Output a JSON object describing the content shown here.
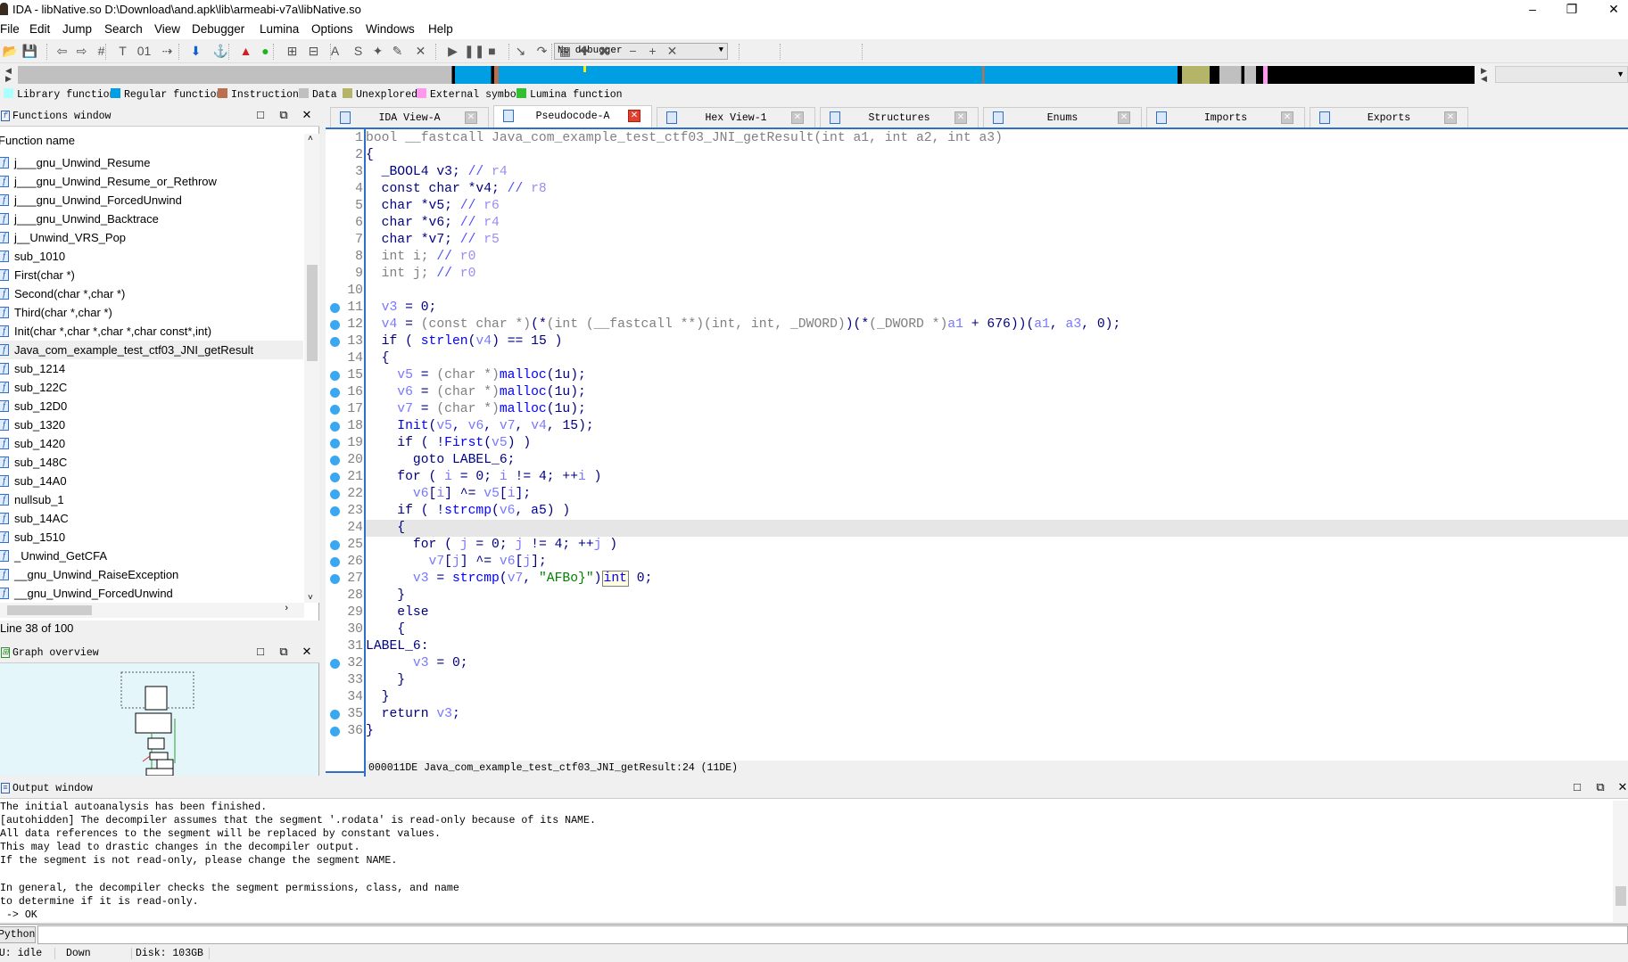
{
  "window": {
    "title": "IDA - libNative.so D:\\Download\\and.apk\\lib\\armeabi-v7a\\libNative.so",
    "minimize": "–",
    "restore": "❐",
    "close": "✕"
  },
  "menu": [
    "File",
    "Edit",
    "Jump",
    "Search",
    "View",
    "Debugger",
    "Lumina",
    "Options",
    "Windows",
    "Help"
  ],
  "toolbar": {
    "debugger_select": "No debugger",
    "icons": [
      "open-icon",
      "save-icon",
      "back-icon",
      "forward-icon",
      "binary-search-icon",
      "text-search-icon",
      "immediate-search-icon",
      "search-next-icon",
      "jump-down-icon",
      "anchor-icon",
      "report-icon",
      "green-ball-icon",
      "code-icon",
      "data-icon",
      "ascii-icon",
      "struct-icon",
      "patch-icon",
      "edit-icon",
      "undefine-icon",
      "run-icon",
      "pause-icon",
      "stop-icon",
      "step-into-icon",
      "step-over-icon",
      "breakpoints-icon",
      "add-breakpoint-icon",
      "delete-breakpoint-icon",
      "collapse-icon",
      "expand-icon",
      "close-icon"
    ]
  },
  "legend": [
    {
      "label": "Library function",
      "color": "#aaffff"
    },
    {
      "label": "Regular function",
      "color": "#009fe3"
    },
    {
      "label": "Instruction",
      "color": "#b87050"
    },
    {
      "label": "Data",
      "color": "#c0c0c0"
    },
    {
      "label": "Unexplored",
      "color": "#b5b56a"
    },
    {
      "label": "External symbol",
      "color": "#ff99ee"
    },
    {
      "label": "Lumina function",
      "color": "#30c030"
    }
  ],
  "functions_window": {
    "title": "Functions window",
    "column": "Function name",
    "selected_index": 10,
    "items": [
      "j___gnu_Unwind_Resume",
      "j___gnu_Unwind_Resume_or_Rethrow",
      "j___gnu_Unwind_ForcedUnwind",
      "j___gnu_Unwind_Backtrace",
      "j__Unwind_VRS_Pop",
      "sub_1010",
      "First(char *)",
      "Second(char *,char *)",
      "Third(char *,char *)",
      "Init(char *,char *,char *,char const*,int)",
      "Java_com_example_test_ctf03_JNI_getResult",
      "sub_1214",
      "sub_122C",
      "sub_12D0",
      "sub_1320",
      "sub_1420",
      "sub_148C",
      "sub_14A0",
      "nullsub_1",
      "sub_14AC",
      "sub_1510",
      "_Unwind_GetCFA",
      "__gnu_Unwind_RaiseException",
      "__gnu_Unwind_ForcedUnwind"
    ],
    "status": "Line 38 of 100"
  },
  "graph_overview": {
    "title": "Graph overview"
  },
  "tabs": [
    {
      "label": "IDA View-A",
      "active": false
    },
    {
      "label": "Pseudocode-A",
      "active": true
    },
    {
      "label": "Hex View-1",
      "active": false
    },
    {
      "label": "Structures",
      "active": false
    },
    {
      "label": "Enums",
      "active": false
    },
    {
      "label": "Imports",
      "active": false
    },
    {
      "label": "Exports",
      "active": false
    }
  ],
  "pseudocode": {
    "highlighted_line": 24,
    "breakpoint_lines": [
      11,
      12,
      13,
      15,
      16,
      17,
      18,
      19,
      20,
      21,
      22,
      23,
      25,
      26,
      27,
      32,
      35,
      36
    ],
    "lines": [
      [
        [
          "t",
          "bool __fastcall Java_com_example_test_ctf03_JNI_getResult(int a1, int a2, int a3)"
        ]
      ],
      [
        [
          "p",
          "{"
        ]
      ],
      [
        [
          "p",
          "  _BOOL4 v3; "
        ],
        [
          "c",
          "// "
        ],
        [
          "r",
          "r4"
        ]
      ],
      [
        [
          "p",
          "  const char *v4; "
        ],
        [
          "c",
          "// "
        ],
        [
          "r",
          "r8"
        ]
      ],
      [
        [
          "p",
          "  char *v5; "
        ],
        [
          "c",
          "// "
        ],
        [
          "r",
          "r6"
        ]
      ],
      [
        [
          "p",
          "  char *v6; "
        ],
        [
          "c",
          "// "
        ],
        [
          "r",
          "r4"
        ]
      ],
      [
        [
          "p",
          "  char *v7; "
        ],
        [
          "c",
          "// "
        ],
        [
          "r",
          "r5"
        ]
      ],
      [
        [
          "t",
          "  int i; "
        ],
        [
          "c",
          "// "
        ],
        [
          "r",
          "r0"
        ]
      ],
      [
        [
          "t",
          "  int j; "
        ],
        [
          "c",
          "// "
        ],
        [
          "r",
          "r0"
        ]
      ],
      [],
      [
        [
          "v",
          "  v3"
        ],
        [
          "p",
          " = 0;"
        ]
      ],
      [
        [
          "v",
          "  v4"
        ],
        [
          "p",
          " = "
        ],
        [
          "t",
          "(const char *)"
        ],
        [
          "p",
          "(*"
        ],
        [
          "t",
          "(int (__fastcall **)(int, int, _DWORD)"
        ],
        [
          "p",
          ")(*"
        ],
        [
          "t",
          "(_DWORD *)"
        ],
        [
          "v",
          "a1"
        ],
        [
          "p",
          " + 676))("
        ],
        [
          "v",
          "a1"
        ],
        [
          "p",
          ", "
        ],
        [
          "v",
          "a3"
        ],
        [
          "p",
          ", 0);"
        ]
      ],
      [
        [
          "p",
          "  if ( "
        ],
        [
          "f",
          "strlen"
        ],
        [
          "p",
          "("
        ],
        [
          "v",
          "v4"
        ],
        [
          "p",
          ") == 15 )"
        ]
      ],
      [
        [
          "p",
          "  {"
        ]
      ],
      [
        [
          "v",
          "    v5"
        ],
        [
          "p",
          " = "
        ],
        [
          "t",
          "(char *)"
        ],
        [
          "f",
          "malloc"
        ],
        [
          "p",
          "(1u);"
        ]
      ],
      [
        [
          "v",
          "    v6"
        ],
        [
          "p",
          " = "
        ],
        [
          "t",
          "(char *)"
        ],
        [
          "f",
          "malloc"
        ],
        [
          "p",
          "(1u);"
        ]
      ],
      [
        [
          "v",
          "    v7"
        ],
        [
          "p",
          " = "
        ],
        [
          "t",
          "(char *)"
        ],
        [
          "f",
          "malloc"
        ],
        [
          "p",
          "(1u);"
        ]
      ],
      [
        [
          "f",
          "    Init"
        ],
        [
          "p",
          "("
        ],
        [
          "v",
          "v5"
        ],
        [
          "p",
          ", "
        ],
        [
          "v",
          "v6"
        ],
        [
          "p",
          ", "
        ],
        [
          "v",
          "v7"
        ],
        [
          "p",
          ", "
        ],
        [
          "v",
          "v4"
        ],
        [
          "p",
          ", 15);"
        ]
      ],
      [
        [
          "p",
          "    if ( !"
        ],
        [
          "f",
          "First"
        ],
        [
          "p",
          "("
        ],
        [
          "v",
          "v5"
        ],
        [
          "p",
          ") )"
        ]
      ],
      [
        [
          "p",
          "      goto LABEL_6;"
        ]
      ],
      [
        [
          "p",
          "    for ( "
        ],
        [
          "v",
          "i"
        ],
        [
          "p",
          " = 0; "
        ],
        [
          "v",
          "i"
        ],
        [
          "p",
          " != 4; ++"
        ],
        [
          "v",
          "i"
        ],
        [
          "p",
          " )"
        ]
      ],
      [
        [
          "v",
          "      v6"
        ],
        [
          "p",
          "["
        ],
        [
          "v",
          "i"
        ],
        [
          "p",
          "] ^= "
        ],
        [
          "v",
          "v5"
        ],
        [
          "p",
          "["
        ],
        [
          "v",
          "i"
        ],
        [
          "p",
          "];"
        ]
      ],
      [
        [
          "p",
          "    if ( !"
        ],
        [
          "f",
          "strcmp"
        ],
        [
          "p",
          "("
        ],
        [
          "v",
          "v6"
        ],
        [
          "p",
          ", "
        ],
        [
          "g",
          "a5"
        ],
        [
          "p",
          ") )"
        ]
      ],
      [
        [
          "p",
          "    {"
        ]
      ],
      [
        [
          "p",
          "      for ( "
        ],
        [
          "v",
          "j"
        ],
        [
          "p",
          " = 0; "
        ],
        [
          "v",
          "j"
        ],
        [
          "p",
          " != 4; ++"
        ],
        [
          "v",
          "j"
        ],
        [
          "p",
          " )"
        ]
      ],
      [
        [
          "v",
          "        v7"
        ],
        [
          "p",
          "["
        ],
        [
          "v",
          "j"
        ],
        [
          "p",
          "] ^= "
        ],
        [
          "v",
          "v6"
        ],
        [
          "p",
          "["
        ],
        [
          "v",
          "j"
        ],
        [
          "p",
          "];"
        ]
      ],
      [
        [
          "v",
          "      v3"
        ],
        [
          "p",
          " = "
        ],
        [
          "f",
          "strcmp"
        ],
        [
          "p",
          "("
        ],
        [
          "v",
          "v7"
        ],
        [
          "p",
          ", "
        ],
        [
          "s",
          "\"AFBo}\""
        ],
        [
          "p",
          ")"
        ],
        [
          "h",
          "int"
        ],
        [
          "p",
          " 0;"
        ]
      ],
      [
        [
          "p",
          "    }"
        ]
      ],
      [
        [
          "p",
          "    else"
        ]
      ],
      [
        [
          "p",
          "    {"
        ]
      ],
      [
        [
          "p",
          "LABEL_6:"
        ]
      ],
      [
        [
          "v",
          "      v3"
        ],
        [
          "p",
          " = 0;"
        ]
      ],
      [
        [
          "p",
          "    }"
        ]
      ],
      [
        [
          "p",
          "  }"
        ]
      ],
      [
        [
          "p",
          "  return "
        ],
        [
          "v",
          "v3"
        ],
        [
          "p",
          ";"
        ]
      ],
      [
        [
          "p",
          "}"
        ]
      ]
    ],
    "status": "000011DE Java_com_example_test_ctf03_JNI_getResult:24 (11DE)"
  },
  "output_window": {
    "title": "Output window",
    "text": "The initial autoanalysis has been finished.\n[autohidden] The decompiler assumes that the segment '.rodata' is read-only because of its NAME.\nAll data references to the segment will be replaced by constant values.\nThis may lead to drastic changes in the decompiler output.\nIf the segment is not read-only, please change the segment NAME.\n\nIn general, the decompiler checks the segment permissions, class, and name\nto determine if it is read-only.\n -> OK"
  },
  "python_button": "Python",
  "statusbar": {
    "au": "AU:  idle",
    "dir": "Down",
    "disk": "Disk: 103GB"
  }
}
